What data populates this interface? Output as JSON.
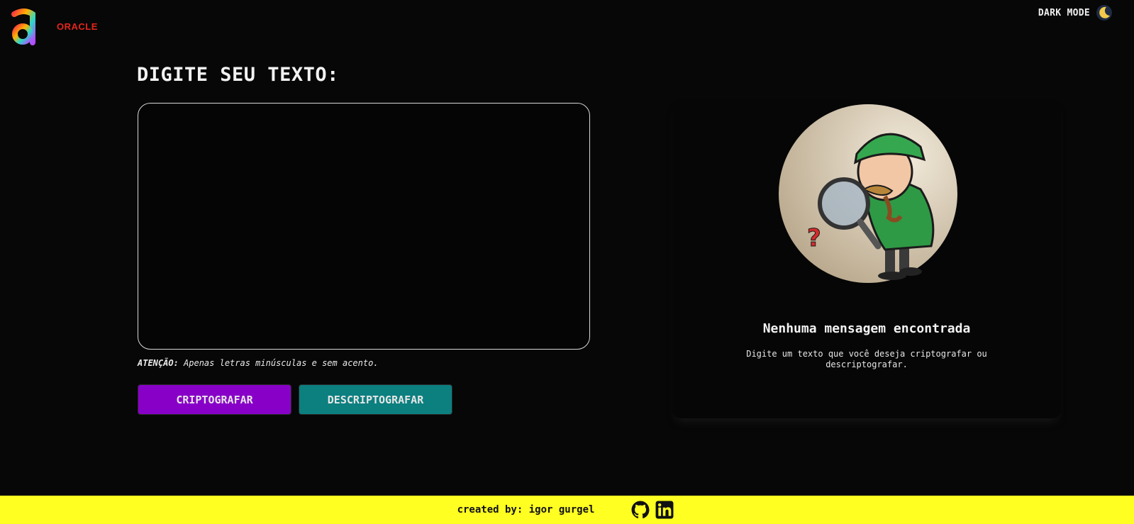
{
  "header": {
    "brand_oracle": "ORACLE",
    "dark_mode_label": "DARK MODE",
    "icons": {
      "logo": "alura-logo-icon",
      "theme_toggle": "moon-icon"
    }
  },
  "editor": {
    "heading": "DIGITE SEU TEXTO:",
    "input_value": "",
    "warning_strong": "ATENÇÃO:",
    "warning_text": " Apenas letras minúsculas e sem acento."
  },
  "buttons": {
    "encrypt": "CRIPTOGRAFAR",
    "decrypt": "DESCRIPTOGRAFAR"
  },
  "result": {
    "title": "Nenhuma mensagem encontrada",
    "description": "Digite um texto que você deseja criptografar ou descriptografar.",
    "illustration": "detective-magnifier-illustration"
  },
  "footer": {
    "credit": "created by: igor gurgel",
    "icons": [
      "github-icon",
      "linkedin-icon"
    ]
  },
  "colors": {
    "background": "#070707",
    "encrypt_button": "#8800c8",
    "decrypt_button": "#0c7f7f",
    "footer": "#ffff22",
    "oracle_brand": "#e3261b"
  }
}
